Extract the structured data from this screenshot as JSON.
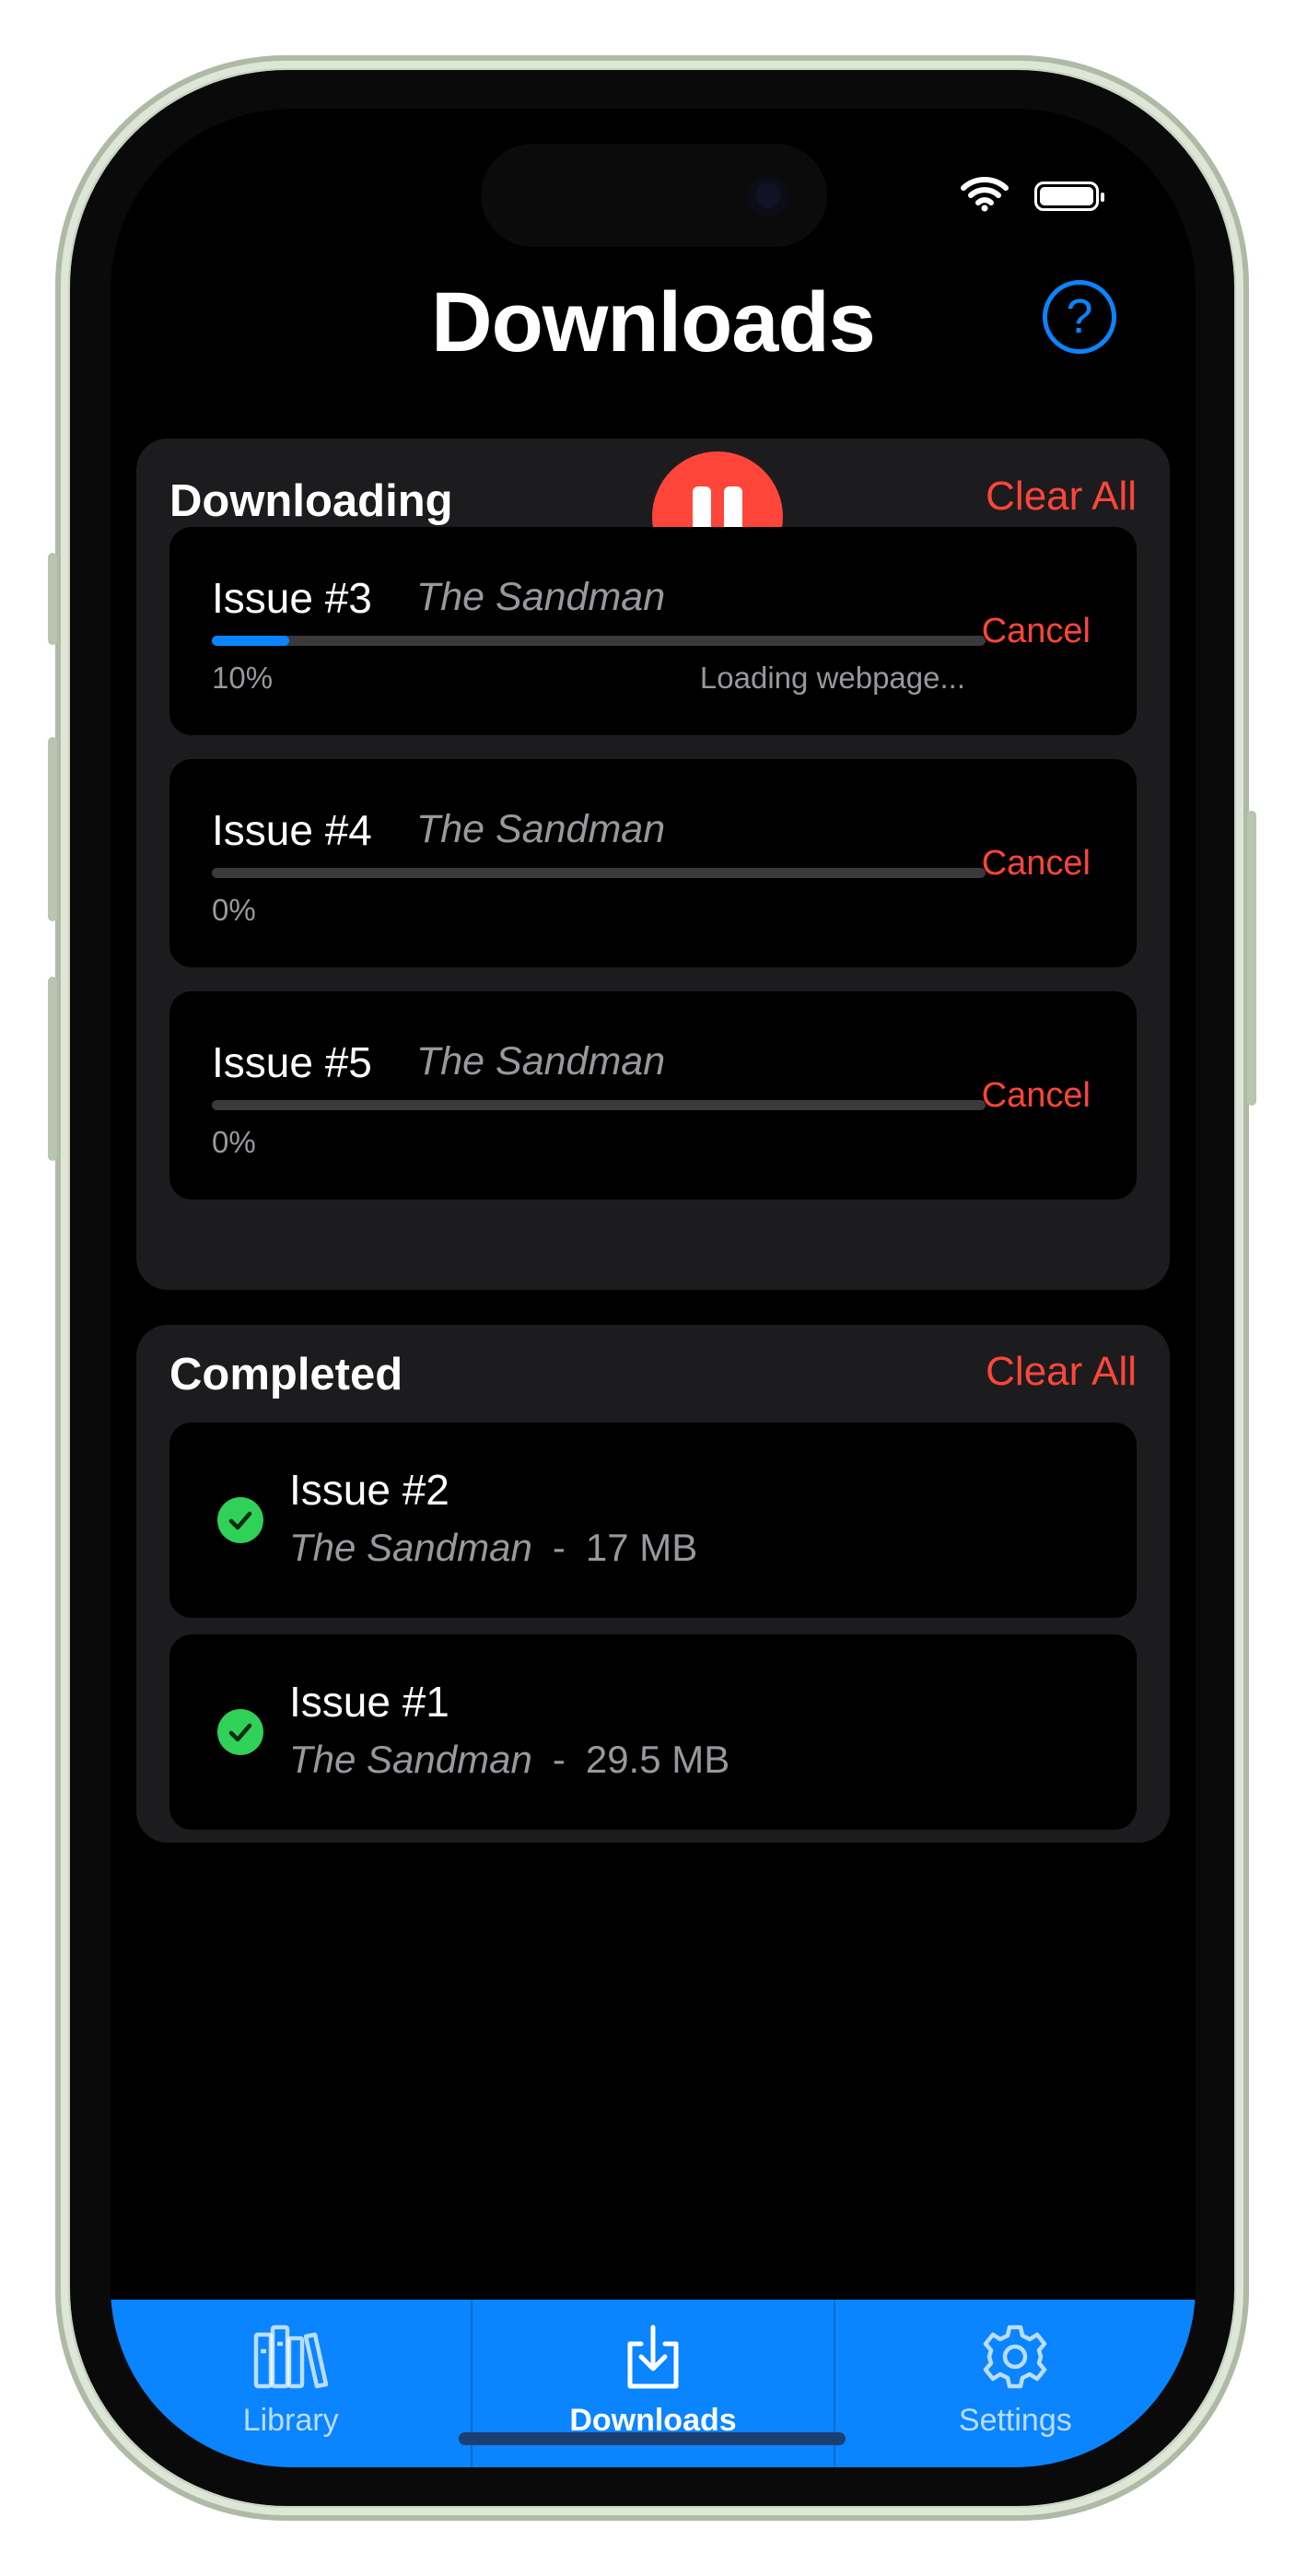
{
  "header": {
    "title": "Downloads",
    "help_label": "?"
  },
  "downloading": {
    "title": "Downloading",
    "clear_label": "Clear All",
    "items": [
      {
        "issue": "Issue #3",
        "series": "The Sandman",
        "percent_label": "10%",
        "progress": 0.1,
        "status": "Loading webpage...",
        "cancel_label": "Cancel"
      },
      {
        "issue": "Issue #4",
        "series": "The Sandman",
        "percent_label": "0%",
        "progress": 0,
        "status": "",
        "cancel_label": "Cancel"
      },
      {
        "issue": "Issue #5",
        "series": "The Sandman",
        "percent_label": "0%",
        "progress": 0,
        "status": "",
        "cancel_label": "Cancel"
      }
    ]
  },
  "completed": {
    "title": "Completed",
    "clear_label": "Clear All",
    "separator": "-",
    "items": [
      {
        "issue": "Issue #2",
        "series": "The Sandman",
        "size": "17 MB"
      },
      {
        "issue": "Issue #1",
        "series": "The Sandman",
        "size": "29.5 MB"
      }
    ]
  },
  "tabs": [
    {
      "label": "Library",
      "icon": "books-icon",
      "active": false
    },
    {
      "label": "Downloads",
      "icon": "download-tray-icon",
      "active": true
    },
    {
      "label": "Settings",
      "icon": "gear-icon",
      "active": false
    }
  ],
  "colors": {
    "accent": "#0a84ff",
    "destructive": "#ff453a",
    "success": "#30d158",
    "card": "#1c1c1e"
  }
}
